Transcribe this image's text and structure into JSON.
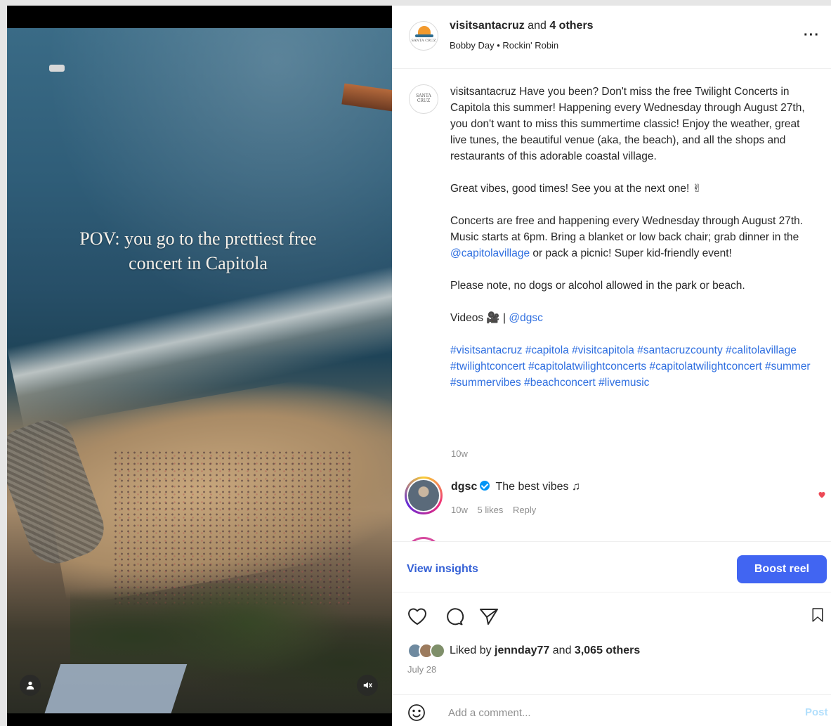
{
  "media": {
    "overlay_caption": "POV: you go to the prettiest free concert in Capitola"
  },
  "header": {
    "username": "visitsantacruz",
    "and_text": "and",
    "others": "4 others",
    "audio": "Bobby Day • Rockin' Robin",
    "logo_text": "SANTA CRUZ",
    "more_glyph": "···"
  },
  "caption": {
    "username": "visitsantacruz",
    "p1": "Have you been? Don't miss the free Twilight Concerts in Capitola this summer! Happening every Wednesday through August 27th, you don't want to miss this summertime classic! Enjoy the weather, great live tunes, the beautiful venue (aka, the beach), and all the shops and restaurants of this adorable coastal village.",
    "p2": "Great vibes, good times! See you at the next one! ✌",
    "p3_a": "Concerts are free and happening every Wednesday through August 27th. Music starts at 6pm. Bring a blanket or low back chair; grab dinner in the",
    "p3_mention": "@capitolavillage",
    "p3_b": "or pack a picnic! Super kid-friendly event!",
    "p4": "Please note, no dogs or alcohol allowed in the park or beach.",
    "p5_a": "Videos 🎥 |",
    "p5_mention": "@dgsc",
    "hashtags": "#visitsantacruz #capitola #visitcapitola #santacruzcounty #calitolavillage #twilightconcert #capitolatwilightconcerts #capitolatwilightconcert #summer #summervibes #beachconcert #livemusic",
    "time": "10w"
  },
  "comment": {
    "username": "dgsc",
    "text": "The best vibes ♫",
    "time": "10w",
    "likes": "5 likes",
    "reply": "Reply"
  },
  "insights": {
    "view_label": "View insights",
    "boost_label": "Boost reel"
  },
  "likes": {
    "prefix": "Liked by",
    "user": "jennday77",
    "and_text": "and",
    "others": "3,065 others"
  },
  "post_date": "July 28",
  "comment_box": {
    "placeholder": "Add a comment...",
    "post_label": "Post"
  },
  "colors": {
    "accent": "#4165f2",
    "link": "#2f6fe0",
    "heart": "#ed4956",
    "muted": "#8e8e8e"
  }
}
